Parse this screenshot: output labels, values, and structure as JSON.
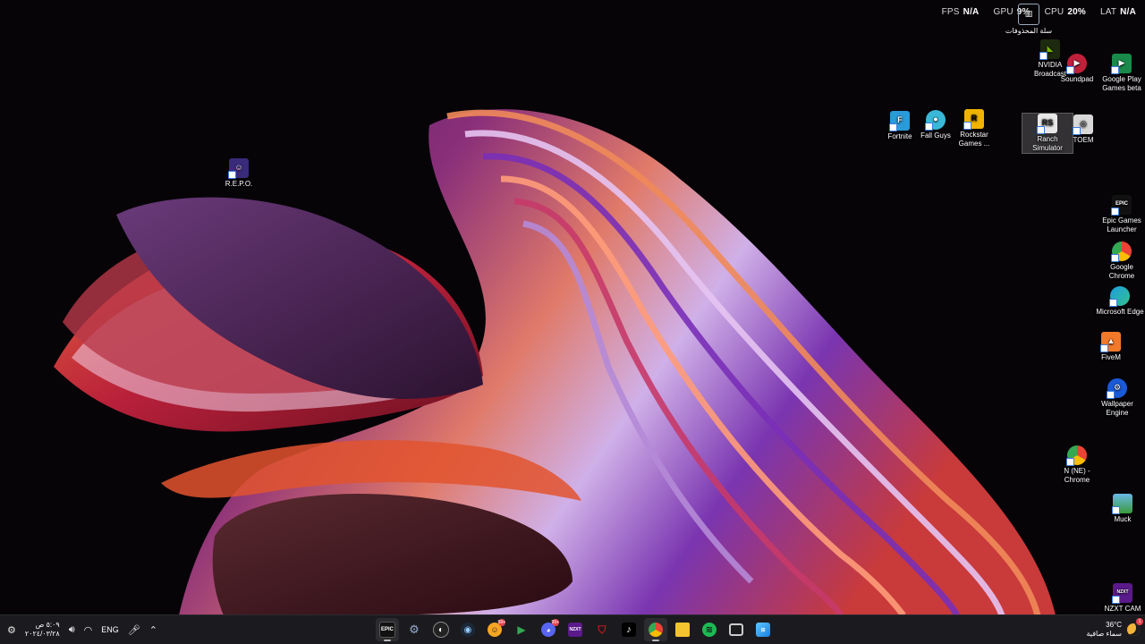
{
  "overlay": {
    "fps_label": "FPS",
    "fps_value": "N/A",
    "gpu_label": "GPU",
    "gpu_value": "9%",
    "cpu_label": "CPU",
    "cpu_value": "20%",
    "lat_label": "LAT",
    "lat_value": "N/A"
  },
  "desktop": {
    "repo": "R.E.P.O.",
    "recycle_bin": "سلة المحذوفات",
    "nvidia": "NVIDIA Broadcast",
    "soundpad": "Soundpad",
    "google_play": "Google Play Games beta",
    "fortnite": "Fortnite",
    "fall_guys": "Fall Guys",
    "rockstar": "Rockstar Games ...",
    "ranch": "Ranch Simulator",
    "toem": "TOEM",
    "epic": "Epic Games Launcher",
    "chrome": "Google Chrome",
    "edge": "Microsoft Edge",
    "fivem": "FiveM",
    "wallpaper_engine": "Wallpaper Engine",
    "n_chrome": "N (NE) - Chrome",
    "muck": "Muck",
    "nzxt": "NZXT CAM"
  },
  "icon_text": {
    "fortnite": "F",
    "rockstar": "R",
    "ranch": "RS",
    "epic": "EPIC",
    "nzxt": "NZXT"
  },
  "taskbar": {
    "clock_time": "٥:٠٩ ص",
    "clock_date": "٢٠٢٤/٠٣/٢٨",
    "language": "ENG",
    "weather_temp": "36°C",
    "weather_text": "سماء صافية",
    "weather_badge": "1",
    "epic_glyph": "EPIC",
    "nzxt_glyph": "NZXT",
    "badge_epic": "99+",
    "badge_discord": "99+"
  },
  "colors": {
    "taskbar_bg": "#1b1b1f",
    "accent_pink": "#d7337a",
    "accent_purple": "#6a2a8a"
  }
}
